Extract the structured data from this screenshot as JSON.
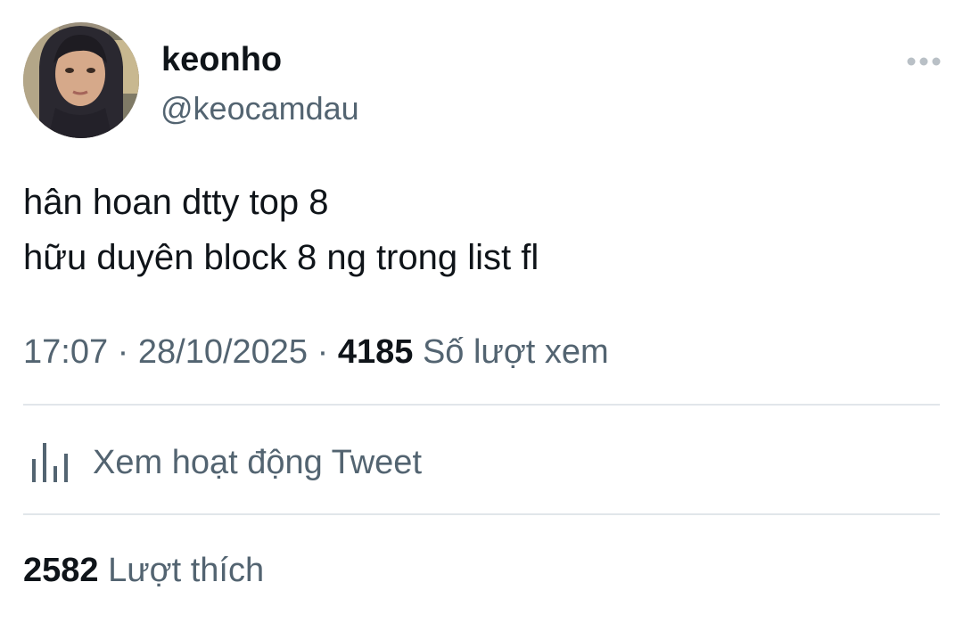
{
  "author": {
    "display_name": "keonho",
    "handle": "@keocamdau",
    "avatar_icon": "profile-photo"
  },
  "more_icon": "more-horizontal-icon",
  "tweet": {
    "lines": [
      "hân hoan dtty top 8",
      "hữu duyên block 8 ng trong list fl"
    ]
  },
  "meta": {
    "time": "17:07",
    "separator": "·",
    "date": "28/10/2025",
    "views_count": "4185",
    "views_label": "Số lượt xem"
  },
  "activity": {
    "icon": "analytics-bars-icon",
    "label": "Xem hoạt động Tweet"
  },
  "likes": {
    "count": "2582",
    "label": "Lượt thích"
  },
  "colors": {
    "primary_text": "#0f1419",
    "secondary_text": "#536471",
    "divider": "#e1e6ea"
  }
}
